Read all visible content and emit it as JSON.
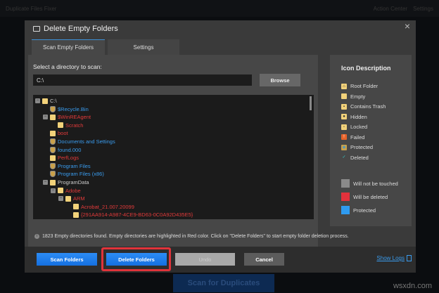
{
  "background": {
    "app_title": "Duplicate Files Fixer",
    "action_center": "Action Center",
    "settings": "Settings",
    "scan_button": "Scan for Duplicates"
  },
  "watermark": "wsxdn.com",
  "dialog": {
    "title": "Delete Empty Folders",
    "close": "×",
    "tabs": [
      {
        "label": "Scan Empty Folders",
        "active": true
      },
      {
        "label": "Settings",
        "active": false
      }
    ],
    "select_label": "Select a directory to scan:",
    "path_value": "C:\\",
    "browse_label": "Browse",
    "tree": [
      {
        "label": "C:\\",
        "depth": 0,
        "icon": "root-folder",
        "color": "wht",
        "toggle": "−"
      },
      {
        "label": "$Recycle.Bin",
        "depth": 1,
        "icon": "protected",
        "color": "blue"
      },
      {
        "label": "$WinREAgent",
        "depth": 1,
        "icon": "empty",
        "color": "red",
        "toggle": "−"
      },
      {
        "label": "Scratch",
        "depth": 2,
        "icon": "empty",
        "color": "red"
      },
      {
        "label": "boot",
        "depth": 1,
        "icon": "empty",
        "color": "red"
      },
      {
        "label": "Documents and Settings",
        "depth": 1,
        "icon": "protected",
        "color": "blue"
      },
      {
        "label": "found.000",
        "depth": 1,
        "icon": "protected",
        "color": "blue"
      },
      {
        "label": "PerfLogs",
        "depth": 1,
        "icon": "empty",
        "color": "red"
      },
      {
        "label": "Program Files",
        "depth": 1,
        "icon": "protected",
        "color": "blue"
      },
      {
        "label": "Program Files (x86)",
        "depth": 1,
        "icon": "protected",
        "color": "blue"
      },
      {
        "label": "ProgramData",
        "depth": 1,
        "icon": "empty",
        "color": "wht",
        "toggle": "−"
      },
      {
        "label": "Adobe",
        "depth": 2,
        "icon": "empty",
        "color": "red",
        "toggle": "−"
      },
      {
        "label": "ARM",
        "depth": 3,
        "icon": "empty",
        "color": "red",
        "toggle": "−"
      },
      {
        "label": "Acrobat_21.007.20099",
        "depth": 4,
        "icon": "empty",
        "color": "red"
      },
      {
        "label": "{291AA914-A987-4CE9-BD63-0C0A92D435E5}",
        "depth": 4,
        "icon": "empty",
        "color": "red"
      }
    ],
    "icon_description": {
      "title": "Icon Description",
      "items": [
        {
          "label": "Root Folder",
          "icon": "root-folder"
        },
        {
          "label": "Empty",
          "icon": "empty"
        },
        {
          "label": "Contains Trash",
          "icon": "trash"
        },
        {
          "label": "Hidden",
          "icon": "hidden"
        },
        {
          "label": "Locked",
          "icon": "locked"
        },
        {
          "label": "Failed",
          "icon": "failed"
        },
        {
          "label": "Protected",
          "icon": "protected"
        },
        {
          "label": "Deleted",
          "icon": "check"
        }
      ],
      "colors": [
        {
          "label": "Will not be touched",
          "color": "#8a8a8a"
        },
        {
          "label": "Will be deleted",
          "color": "#e2323c"
        },
        {
          "label": "Protected",
          "color": "#2f9bf0"
        }
      ]
    },
    "info": "1823 Empty directories found. Empty directories are highlighted in Red color. Click on \"Delete Folders\" to start empty folder deletion process.",
    "buttons": {
      "scan": "Scan Folders",
      "delete": "Delete Folders",
      "undo": "Undo",
      "cancel": "Cancel",
      "logs": "Show Logs"
    }
  }
}
